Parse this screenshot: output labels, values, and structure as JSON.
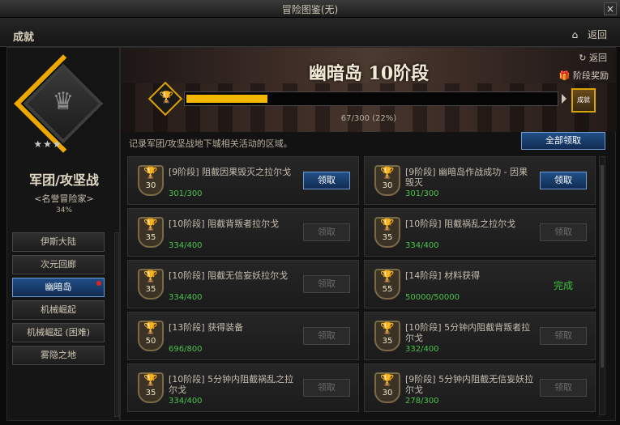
{
  "window": {
    "title": "冒险图鉴(无)",
    "close": "×"
  },
  "header": {
    "section": "成就",
    "back": "返回"
  },
  "left": {
    "category": "军团/攻坚战",
    "rank": "<名誉冒险家>",
    "percent": "34%",
    "nav": [
      {
        "label": "伊斯大陆",
        "active": false
      },
      {
        "label": "次元回廊",
        "active": false
      },
      {
        "label": "幽暗岛",
        "active": true
      },
      {
        "label": "机械崛起",
        "active": false
      },
      {
        "label": "机械崛起 (困难)",
        "active": false
      },
      {
        "label": "雾隐之地",
        "active": false
      }
    ]
  },
  "banner": {
    "title": "幽暗岛 10阶段",
    "back": "返回",
    "reward": "阶段奖励",
    "progress_text": "67/300 (22%)",
    "progress": 0.22,
    "chest": "成就"
  },
  "desc": "记录军团/攻坚战地下城相关活动的区域。",
  "claim_all": "全部领取",
  "achievements": [
    {
      "name": "[9阶段] 阻截因果毁灭之拉尔戈",
      "count": "301/300",
      "level": "30",
      "action": "领取",
      "state": "enabled"
    },
    {
      "name": "[9阶段] 幽暗岛作战成功 - 因果毁灭",
      "count": "301/300",
      "level": "30",
      "action": "领取",
      "state": "enabled"
    },
    {
      "name": "[10阶段] 阻截背叛者拉尔戈",
      "count": "334/400",
      "level": "35",
      "action": "领取",
      "state": "disabled"
    },
    {
      "name": "[10阶段] 阻截祸乱之拉尔戈",
      "count": "334/400",
      "level": "35",
      "action": "领取",
      "state": "disabled"
    },
    {
      "name": "[10阶段] 阻截无信妄妖拉尔戈",
      "count": "334/400",
      "level": "35",
      "action": "领取",
      "state": "disabled"
    },
    {
      "name": "[14阶段] 材料获得",
      "count": "50000/50000",
      "level": "55",
      "action": "完成",
      "state": "done"
    },
    {
      "name": "[13阶段] 获得装备",
      "count": "696/800",
      "level": "50",
      "action": "领取",
      "state": "disabled"
    },
    {
      "name": "[10阶段] 5分钟内阻截背叛者拉尔戈",
      "count": "332/400",
      "level": "35",
      "action": "领取",
      "state": "disabled"
    },
    {
      "name": "[10阶段] 5分钟内阻截祸乱之拉尔戈",
      "count": "334/400",
      "level": "35",
      "action": "领取",
      "state": "disabled"
    },
    {
      "name": "[9阶段] 5分钟内阻截无信妄妖拉尔戈",
      "count": "278/300",
      "level": "30",
      "action": "领取",
      "state": "disabled"
    }
  ]
}
